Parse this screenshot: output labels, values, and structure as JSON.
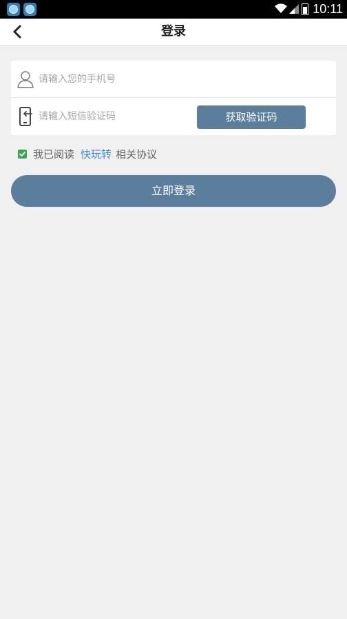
{
  "status_bar": {
    "time": "10:11",
    "icons": [
      "app-icon",
      "app-icon",
      "wifi-icon",
      "signal-icon",
      "battery-icon"
    ]
  },
  "header": {
    "title": "登录",
    "back_icon": "back-arrow-icon"
  },
  "form": {
    "phone": {
      "value": "",
      "placeholder": "请输入您的手机号",
      "icon": "user-icon"
    },
    "sms_code": {
      "value": "",
      "placeholder": "请输入短信验证码",
      "icon": "phone-login-icon",
      "button_label": "获取验证码"
    }
  },
  "agreement": {
    "checked": true,
    "prefix": "我已阅读",
    "link": "快玩转",
    "suffix": "相关协议"
  },
  "login_button": {
    "label": "立即登录"
  },
  "colors": {
    "primary": "#5a7e9c",
    "link": "#3b8bd1",
    "checkbox": "#3aa757",
    "background": "#f0f0f0"
  }
}
